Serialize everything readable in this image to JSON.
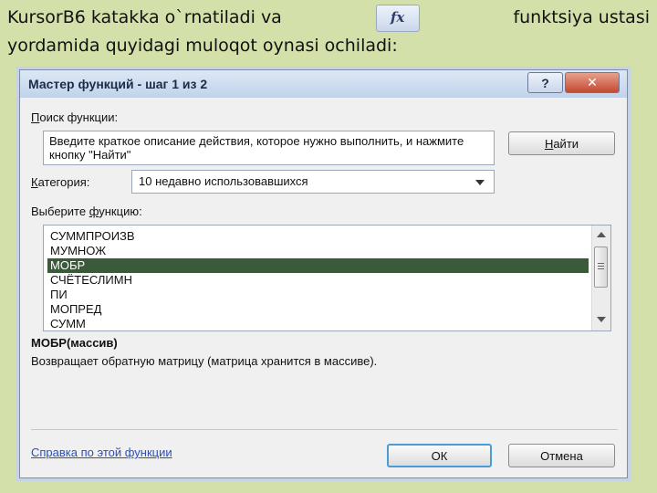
{
  "slide": {
    "line1_left": "KursorB6 katakka o`rnatiladi va",
    "fx_icon_text": "fx",
    "line1_right": "funktsiya ustasi",
    "line2": "yordamida quyidagi muloqot oynasi ochiladi:"
  },
  "dialog": {
    "title": "Мастер функций - шаг 1 из 2",
    "help_button": "?",
    "close_button": "✕",
    "search_label_first": "П",
    "search_label_rest": "оиск функции:",
    "search_text": "Введите краткое описание действия, которое нужно выполнить, и нажмите кнопку \"Найти\"",
    "find_button_first": "Н",
    "find_button_rest": "айти",
    "category_label_first": "К",
    "category_label_rest": "атегория:",
    "category_value": "10 недавно использовавшихся",
    "select_label_a": "Выберите ",
    "select_label_u": "ф",
    "select_label_b": "ункцию:",
    "functions": [
      "СУММПРОИЗВ",
      "МУМНОЖ",
      "МОБР",
      "СЧЁТЕСЛИМН",
      "ПИ",
      "МОПРЕД",
      "СУММ"
    ],
    "selected_function": "МОБР",
    "signature": "МОБР(массив)",
    "description": "Возвращает обратную матрицу (матрица хранится в массиве).",
    "help_link": "Справка по этой функции",
    "ok_button": "ОК",
    "cancel_button": "Отмена"
  }
}
